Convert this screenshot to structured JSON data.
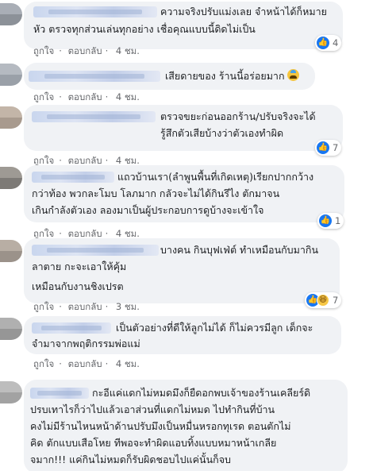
{
  "labels": {
    "like": "ถูกใจ",
    "reply": "ตอบกลับ",
    "separator": "·"
  },
  "colors": {
    "bubble": "#f0f2f5",
    "link": "#65676b",
    "like_blue": "#1877f2"
  },
  "comments": [
    {
      "lines": [
        "ความจริงปรับแม่งเลย จำหน้าได้ก็หมาย",
        "หัว ตรวจทุกส่วนเล่นทุกอย่าง เชื่อคุณแบบนี้ดิดไม่เป็น"
      ],
      "time": "4 ชม.",
      "reactions": {
        "icons": [
          "like-icon"
        ],
        "count": "4"
      }
    },
    {
      "lines": [
        "เสียดายของ ร้านนี้อร่อยมาก"
      ],
      "emoji": "anxious-face-icon",
      "time": "4 ชม."
    },
    {
      "lines": [
        "ตรวจขยะก่อนออกร้าน/ปรับจริงจะได้",
        "รู้สึกตัวเสียบ้างว่าตัวเองทำผิด"
      ],
      "time": "4 ชม.",
      "reactions": {
        "icons": [
          "like-icon"
        ],
        "count": "7"
      }
    },
    {
      "lines": [
        "แถวบ้านเรา(ลำพูนพื้นที่เกิดเหตุ)เรียกปากกว้าง",
        "กว่าท้อง พวกละโมบ โลภมาก กลัวจะไม่ได้กินรึไง ตักมาจน",
        "เกินกำลังตัวเอง ลองมาเป็นผู้ประกอบการดูบ้างจะเข้าใจ"
      ],
      "time": "4 ชม.",
      "reactions": {
        "icons": [
          "like-icon"
        ],
        "count": "1"
      }
    },
    {
      "lines": [
        "บางคน กินบุฟเฟ่ต์ ทำเหมือนกับมากิน",
        "ลาตาย กะจะเอาให้คุ้ม",
        "เหมือนกับงานชิงเปรต"
      ],
      "time": "3 ชม.",
      "reactions": {
        "icons": [
          "like-icon",
          "haha-icon"
        ],
        "count": "7"
      }
    },
    {
      "lines": [
        "เป็นตัวอย่างที่ดีให้ลูกไม่ได้ ก็ไม่ควรมีลูก เด็กจะ",
        "จำมาจากพฤติกรรมพ่อแม่"
      ],
      "time": "4 ชม."
    },
    {
      "lines": [
        "กะอีแค่แดกไม่หมดมึงก็ยืดอกพบเจ้าของร้านเคลียร์ดิ",
        "ปรบเทาไรก็ว่าไปแล้วเอาส่วนที่แดกไม่หมด ไปทำกินที่บ้าน",
        "คงไม่มีร้านไหนหน้าด้านปรับมึงเป็นหมื่นหรอกทุเรด ตอนตักไม่",
        "คิด ตักแบบเสือโหย ทีพอจะทำผิดแอบทิ้งแบบหมาหน้าเกลีย",
        "จมาก!!! แค่กินไม่หมดก็รับผิดชอบไปแค่นั้นก็จบ"
      ]
    }
  ]
}
